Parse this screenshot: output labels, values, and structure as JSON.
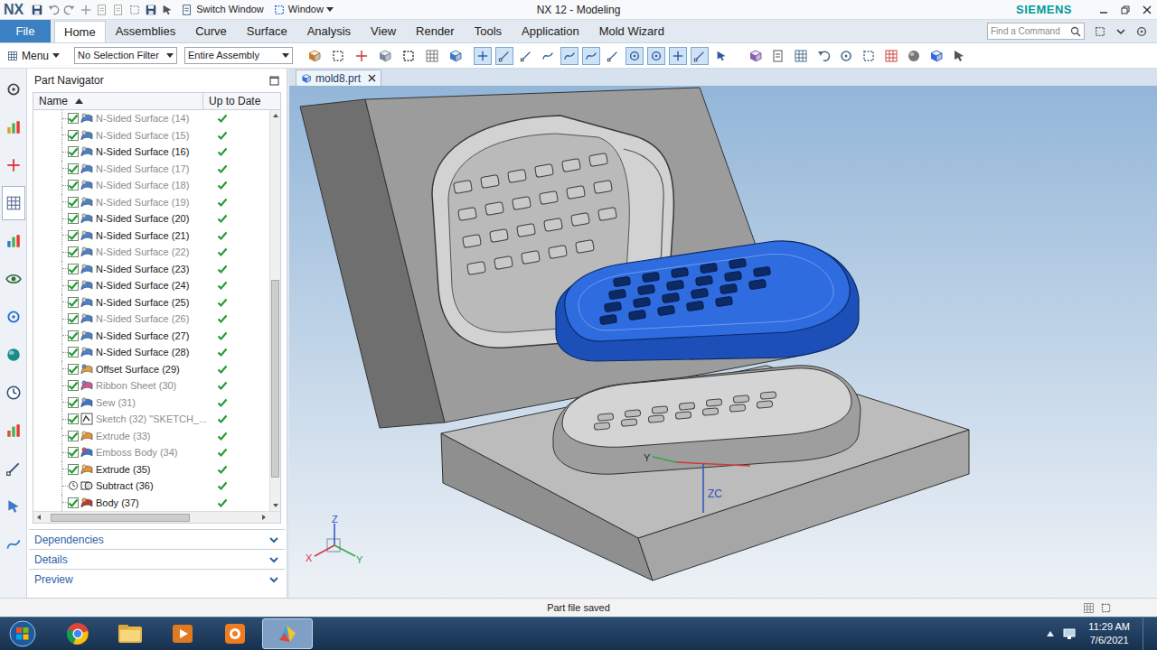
{
  "window": {
    "logo": "NX",
    "title": "NX 12 - Modeling",
    "brand": "SIEMENS",
    "switch_window": "Switch Window",
    "window_menu": "Window"
  },
  "ribbon": {
    "tabs": [
      {
        "label": "File",
        "selected": false,
        "kind": "file"
      },
      {
        "label": "Home",
        "selected": true,
        "kind": "tab"
      },
      {
        "label": "Assemblies",
        "selected": false,
        "kind": "tab"
      },
      {
        "label": "Curve",
        "selected": false,
        "kind": "tab"
      },
      {
        "label": "Surface",
        "selected": false,
        "kind": "tab"
      },
      {
        "label": "Analysis",
        "selected": false,
        "kind": "tab"
      },
      {
        "label": "View",
        "selected": false,
        "kind": "tab"
      },
      {
        "label": "Render",
        "selected": false,
        "kind": "tab"
      },
      {
        "label": "Tools",
        "selected": false,
        "kind": "tab"
      },
      {
        "label": "Application",
        "selected": false,
        "kind": "tab"
      },
      {
        "label": "Mold Wizard",
        "selected": false,
        "kind": "tab"
      }
    ],
    "search": {
      "placeholder": "Find a Command"
    }
  },
  "toolbar": {
    "menu": "Menu",
    "selection_filter": "No Selection Filter",
    "scope": "Entire Assembly",
    "snap_buttons": [
      {
        "on": true
      },
      {
        "on": true
      },
      {
        "on": false
      },
      {
        "on": false
      },
      {
        "on": true
      },
      {
        "on": true
      },
      {
        "on": false
      },
      {
        "on": true
      },
      {
        "on": true
      },
      {
        "on": true
      },
      {
        "on": true
      },
      {
        "on": false
      }
    ]
  },
  "resource_bar": {
    "items": [
      {
        "selected": false
      },
      {
        "selected": false
      },
      {
        "selected": false
      },
      {
        "selected": true
      },
      {
        "selected": false
      },
      {
        "selected": false
      },
      {
        "selected": false
      },
      {
        "selected": false
      },
      {
        "selected": false
      },
      {
        "selected": false
      },
      {
        "selected": false
      },
      {
        "selected": false
      },
      {
        "selected": false
      }
    ]
  },
  "part_navigator": {
    "title": "Part Navigator",
    "columns": [
      {
        "label": "Name",
        "sort": "ascending"
      },
      {
        "label": "Up to Date",
        "sort": "none"
      }
    ],
    "rows": [
      {
        "name": "N-Sided Surface (14)",
        "kind": "nsided",
        "checkbox": true,
        "checked": true,
        "greyed": true,
        "up_to_date": true
      },
      {
        "name": "N-Sided Surface (15)",
        "kind": "nsided",
        "checkbox": true,
        "checked": true,
        "greyed": true,
        "up_to_date": true
      },
      {
        "name": "N-Sided Surface (16)",
        "kind": "nsided",
        "checkbox": true,
        "checked": true,
        "greyed": false,
        "up_to_date": true
      },
      {
        "name": "N-Sided Surface (17)",
        "kind": "nsided",
        "checkbox": true,
        "checked": true,
        "greyed": true,
        "up_to_date": true
      },
      {
        "name": "N-Sided Surface (18)",
        "kind": "nsided",
        "checkbox": true,
        "checked": true,
        "greyed": true,
        "up_to_date": true
      },
      {
        "name": "N-Sided Surface (19)",
        "kind": "nsided",
        "checkbox": true,
        "checked": true,
        "greyed": true,
        "up_to_date": true
      },
      {
        "name": "N-Sided Surface (20)",
        "kind": "nsided",
        "checkbox": true,
        "checked": true,
        "greyed": false,
        "up_to_date": true
      },
      {
        "name": "N-Sided Surface (21)",
        "kind": "nsided",
        "checkbox": true,
        "checked": true,
        "greyed": false,
        "up_to_date": true
      },
      {
        "name": "N-Sided Surface (22)",
        "kind": "nsided",
        "checkbox": true,
        "checked": true,
        "greyed": true,
        "up_to_date": true
      },
      {
        "name": "N-Sided Surface (23)",
        "kind": "nsided",
        "checkbox": true,
        "checked": true,
        "greyed": false,
        "up_to_date": true
      },
      {
        "name": "N-Sided Surface (24)",
        "kind": "nsided",
        "checkbox": true,
        "checked": true,
        "greyed": false,
        "up_to_date": true
      },
      {
        "name": "N-Sided Surface (25)",
        "kind": "nsided",
        "checkbox": true,
        "checked": true,
        "greyed": false,
        "up_to_date": true
      },
      {
        "name": "N-Sided Surface (26)",
        "kind": "nsided",
        "checkbox": true,
        "checked": true,
        "greyed": true,
        "up_to_date": true
      },
      {
        "name": "N-Sided Surface (27)",
        "kind": "nsided",
        "checkbox": true,
        "checked": true,
        "greyed": false,
        "up_to_date": true
      },
      {
        "name": "N-Sided Surface (28)",
        "kind": "nsided",
        "checkbox": true,
        "checked": true,
        "greyed": false,
        "up_to_date": true
      },
      {
        "name": "Offset Surface (29)",
        "kind": "offset",
        "checkbox": true,
        "checked": true,
        "greyed": false,
        "up_to_date": true
      },
      {
        "name": "Ribbon Sheet (30)",
        "kind": "ribbon",
        "checkbox": true,
        "checked": true,
        "greyed": true,
        "up_to_date": true
      },
      {
        "name": "Sew (31)",
        "kind": "sew",
        "checkbox": true,
        "checked": true,
        "greyed": true,
        "up_to_date": true
      },
      {
        "name": "Sketch (32) \"SKETCH_...",
        "kind": "sketch",
        "checkbox": true,
        "checked": true,
        "greyed": true,
        "up_to_date": true
      },
      {
        "name": "Extrude (33)",
        "kind": "extrude",
        "checkbox": true,
        "checked": true,
        "greyed": true,
        "up_to_date": true
      },
      {
        "name": "Emboss Body (34)",
        "kind": "emboss",
        "checkbox": true,
        "checked": true,
        "greyed": true,
        "up_to_date": true
      },
      {
        "name": "Extrude (35)",
        "kind": "extrude",
        "checkbox": true,
        "checked": true,
        "greyed": false,
        "up_to_date": true
      },
      {
        "name": "Subtract (36)",
        "kind": "subtract",
        "checkbox": false,
        "checked": false,
        "greyed": false,
        "up_to_date": true
      },
      {
        "name": "Body (37)",
        "kind": "body",
        "checkbox": true,
        "checked": true,
        "greyed": false,
        "up_to_date": true
      }
    ],
    "vertical_scroll": {
      "thumb_start": 0.42,
      "thumb_size": 0.52
    },
    "horizontal_scroll": {
      "thumb_start": 0.03,
      "thumb_size": 0.65
    },
    "sections": [
      {
        "label": "Dependencies",
        "expanded": false
      },
      {
        "label": "Details",
        "expanded": false
      },
      {
        "label": "Preview",
        "expanded": false
      }
    ]
  },
  "graphics": {
    "tab": {
      "label": "mold8.prt"
    },
    "wcs_labels": {
      "z": "ZC",
      "y": "Y"
    },
    "view_triad": {
      "z": "Z",
      "x": "X",
      "y": "Y"
    }
  },
  "status_bar": {
    "message": "Part file saved"
  },
  "taskbar": {
    "apps": [
      {
        "selected": false
      },
      {
        "selected": false
      },
      {
        "selected": false
      },
      {
        "selected": false
      },
      {
        "selected": true
      }
    ],
    "time": "11:29 AM",
    "date": "7/6/2021"
  }
}
